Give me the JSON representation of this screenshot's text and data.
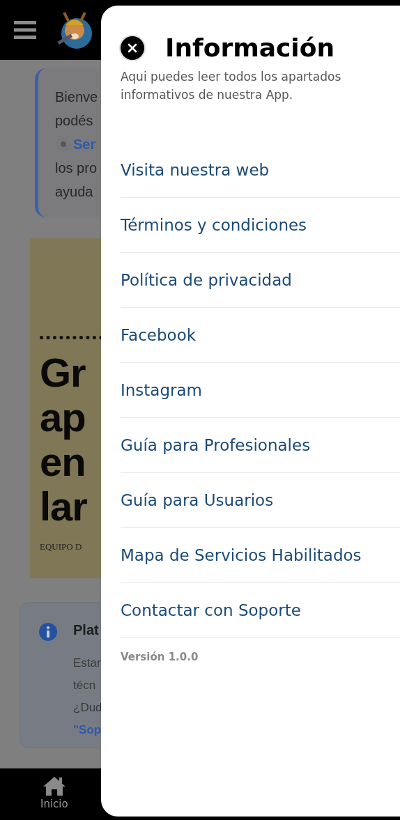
{
  "page": {
    "welcome_card": {
      "lines": [
        {
          "text": "Bienve",
          "kind": "plain"
        },
        {
          "text": "podés",
          "kind": "plain"
        },
        {
          "text": "Ser",
          "kind": "link"
        },
        {
          "text": "los pro",
          "kind": "plain"
        },
        {
          "text": "ayuda",
          "kind": "plain"
        }
      ]
    },
    "banner": {
      "headline": [
        "Gr",
        "ap",
        "en",
        "lar"
      ],
      "caption": "EQUIPO D"
    },
    "info_card": {
      "title": "Plat",
      "lines": [
        {
          "text": "Estar",
          "kind": "plain"
        },
        {
          "text": "técn",
          "kind": "plain"
        },
        {
          "text": "¿Dud",
          "kind": "plain"
        },
        {
          "text": "\"Sop",
          "kind": "link"
        }
      ]
    },
    "bottom_nav": [
      {
        "label": "Inicio"
      }
    ]
  },
  "drawer": {
    "title": "Información",
    "subtitle": "Aqui puedes leer todos los apartados informativos de nuestra App.",
    "items": [
      {
        "label": "Visita nuestra web"
      },
      {
        "label": "Términos y condiciones"
      },
      {
        "label": "Política de privacidad"
      },
      {
        "label": "Facebook"
      },
      {
        "label": "Instagram"
      },
      {
        "label": "Guía para Profesionales"
      },
      {
        "label": "Guía para Usuarios"
      },
      {
        "label": "Mapa de Servicios Habilitados"
      },
      {
        "label": "Contactar con Soporte"
      }
    ],
    "version": "Versión 1.0.0"
  }
}
